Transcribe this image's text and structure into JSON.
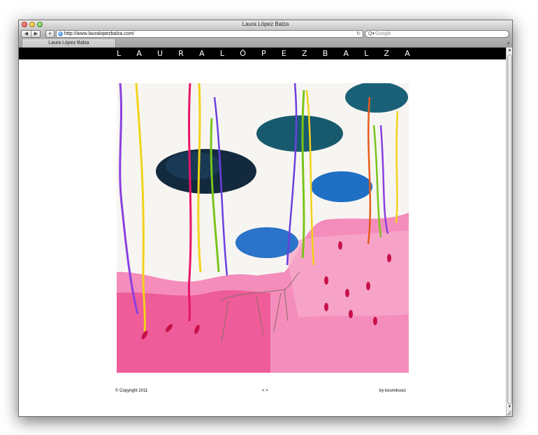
{
  "window": {
    "title": "Laura López Balza"
  },
  "toolbar": {
    "back_icon": "◀",
    "forward_icon": "▶",
    "add_icon": "+",
    "url": "http://www.lauralopezbalza.com/",
    "reload_icon": "↻",
    "search_icon": "Q▾",
    "search_placeholder": "Google"
  },
  "tabs": [
    {
      "label": "Laura López Balza"
    }
  ],
  "newtab_icon": "+",
  "site": {
    "name_letters": [
      "L",
      "A",
      "U",
      "R",
      "A",
      "L",
      "Ó",
      "P",
      "E",
      "Z",
      "B",
      "A",
      "L",
      "Z",
      "A"
    ],
    "footer": {
      "copyright": "© Copyright 2011",
      "nav": "< >",
      "credit": "by kosmiksoul"
    }
  },
  "scrollbar": {
    "up_icon": "▲",
    "down_icon": "▼"
  },
  "colors": {
    "site_bar": "#000000",
    "painting_pink": "#f06fa6",
    "cloud_dark": "#16324a",
    "cloud_teal": "#1b5e73",
    "cloud_blue": "#1f6fc4"
  }
}
